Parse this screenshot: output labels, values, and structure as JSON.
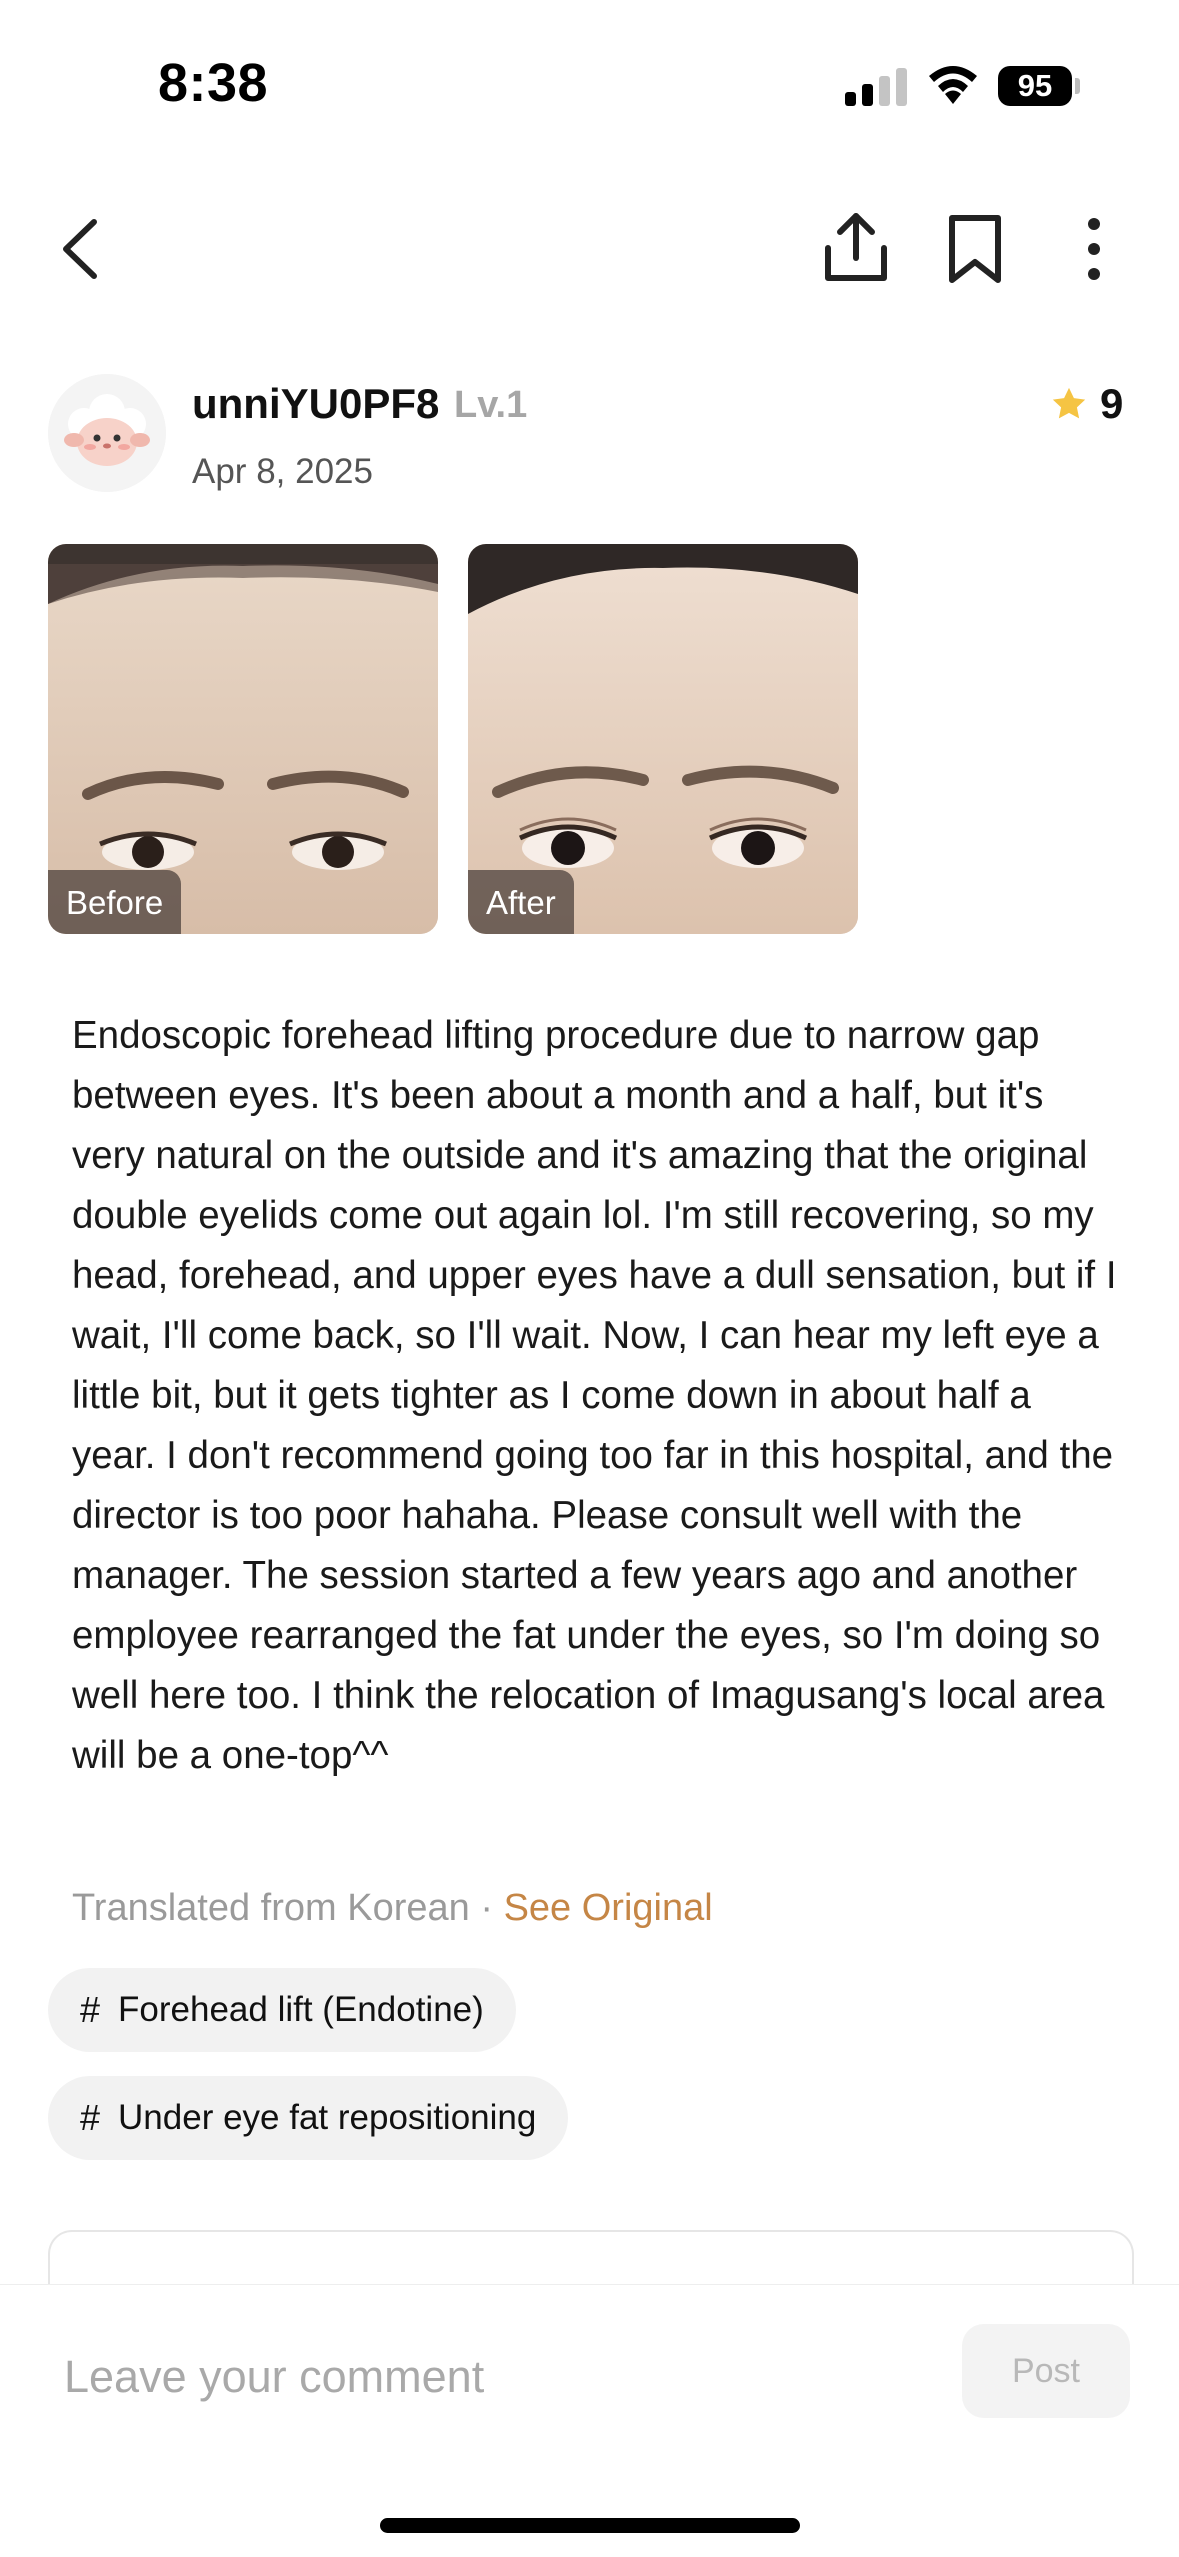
{
  "status_bar": {
    "time": "8:38",
    "battery": "95"
  },
  "nav": {
    "back_icon": "chevron-left-icon",
    "share_icon": "share-icon",
    "bookmark_icon": "bookmark-icon",
    "more_icon": "more-vertical-icon"
  },
  "post": {
    "author": "unniYU0PF8",
    "level": "Lv.1",
    "date": "Apr 8, 2025",
    "rating": "9",
    "rating_color": "#f5c443",
    "photos": [
      {
        "label": "Before"
      },
      {
        "label": "After"
      }
    ],
    "body": "Endoscopic forehead lifting procedure due to narrow gap between eyes. It's been about a month and a half, but it's very natural on the outside and it's amazing that the original double eyelids come out again lol. I'm still recovering, so my head, forehead, and upper eyes have a dull sensation, but if I wait, I'll come back, so I'll wait. Now, I can hear my left eye a little bit, but it gets tighter as I come down in about half a year. I don't recommend going too far in this hospital, and the director is too poor hahaha. Please consult well with the manager. The session started a few years ago and another employee rearranged the fat under the eyes, so I'm doing so well here too. I think the relocation of Imagusang's local area will be a one-top^^",
    "translated_note": "Translated from Korean",
    "separator": "·",
    "see_original": "See Original",
    "accent_color": "#c58646",
    "tags": [
      {
        "hash": "#",
        "label": "Forehead lift (Endotine)"
      },
      {
        "hash": "#",
        "label": "Under eye fat repositioning"
      }
    ]
  },
  "comment": {
    "placeholder": "Leave your comment",
    "post_label": "Post"
  }
}
